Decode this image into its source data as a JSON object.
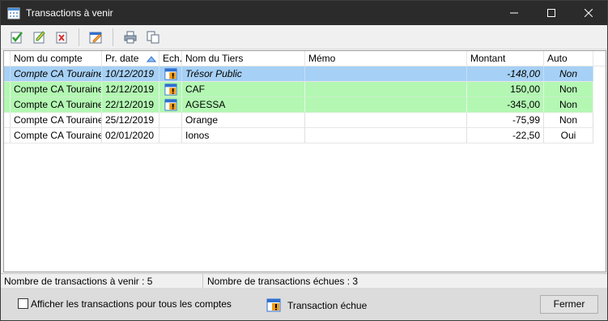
{
  "window": {
    "title": "Transactions à venir",
    "minimize_glyph": "—",
    "maximize_glyph": "☐",
    "close_glyph": "✕"
  },
  "toolbar": {
    "buttons": [
      {
        "name": "validate-icon",
        "color": "#2e9e2e"
      },
      {
        "name": "edit-icon",
        "color": "#2e9e2e"
      },
      {
        "name": "delete-icon",
        "color": "#d32f2f"
      },
      {
        "name": "calendar-edit-icon",
        "color": "#2f6fd0"
      },
      {
        "name": "print-icon",
        "color": "#5a6b80"
      },
      {
        "name": "copy-icon",
        "color": "#5a6b80"
      }
    ]
  },
  "table": {
    "columns": [
      "Nom du compte",
      "Pr. date",
      "Ech.",
      "Nom du Tiers",
      "Mémo",
      "Montant",
      "Auto"
    ],
    "rows": [
      {
        "account": "Compte CA Touraine",
        "date": "10/12/2019",
        "due": true,
        "payee": "Trésor Public",
        "memo": "",
        "amount": "-148,00",
        "auto": "Non",
        "state": "selected"
      },
      {
        "account": "Compte CA Touraine",
        "date": "12/12/2019",
        "due": true,
        "payee": "CAF",
        "memo": "",
        "amount": "150,00",
        "auto": "Non",
        "state": "green"
      },
      {
        "account": "Compte CA Touraine",
        "date": "22/12/2019",
        "due": true,
        "payee": "AGESSA",
        "memo": "",
        "amount": "-345,00",
        "auto": "Non",
        "state": "green"
      },
      {
        "account": "Compte CA Touraine",
        "date": "25/12/2019",
        "due": false,
        "payee": "Orange",
        "memo": "",
        "amount": "-75,99",
        "auto": "Non",
        "state": "normal"
      },
      {
        "account": "Compte CA Touraine",
        "date": "02/01/2020",
        "due": false,
        "payee": "Ionos",
        "memo": "",
        "amount": "-22,50",
        "auto": "Oui",
        "state": "normal"
      }
    ]
  },
  "status": {
    "upcoming": "Nombre de transactions à venir : 5",
    "due": "Nombre de transactions échues : 3"
  },
  "footer": {
    "show_all_label": "Afficher les transactions pour tous les comptes",
    "show_all_checked": false,
    "legend_label": "Transaction échue",
    "close_label": "Fermer"
  },
  "colors": {
    "selected_row": "#a6d0f5",
    "due_row": "#b3f7b3",
    "titlebar": "#2b2b2b"
  }
}
